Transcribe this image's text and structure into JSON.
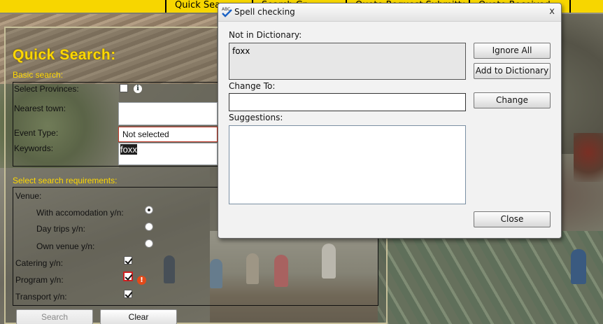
{
  "nav": {
    "tabs": [
      {
        "label": "Quick Search"
      },
      {
        "label": "Search Gr..."
      },
      {
        "label": "Quote Request Submitted"
      },
      {
        "label": "Quote Received"
      }
    ]
  },
  "search": {
    "title": "Quick Search:",
    "basic_label": "Basic search:",
    "provinces_label": "Select Provinces:",
    "nearest_town_label": "Nearest town:",
    "event_type_label": "Event Type:",
    "event_type_value": "Not selected",
    "keywords_label": "Keywords:",
    "keywords_value": "foxx",
    "requirements_label": "Select search requirements:",
    "venue_label": "Venue:",
    "venue_options": [
      {
        "label": "With accomodation y/n:",
        "selected": true
      },
      {
        "label": "Day trips y/n:",
        "selected": false
      },
      {
        "label": "Own venue y/n:",
        "selected": false
      }
    ],
    "catering_label": "Catering y/n:",
    "program_label": "Program y/n:",
    "transport_label": "Transport y/n:",
    "search_button": "Search",
    "clear_button": "Clear"
  },
  "dialog": {
    "title": "Spell checking",
    "close_glyph": "x",
    "not_in_dict_label": "Not in Dictionary:",
    "not_in_dict_word": "foxx",
    "change_to_label": "Change To:",
    "change_to_value": "",
    "suggestions_label": "Suggestions:",
    "ignore_all_button": "Ignore All",
    "add_to_dictionary_button": "Add to Dictionary",
    "change_button": "Change",
    "close_button": "Close"
  },
  "colors": {
    "nav_bg": "#f7d600",
    "title_yellow": "#ffd800",
    "error_red": "#d02020"
  }
}
